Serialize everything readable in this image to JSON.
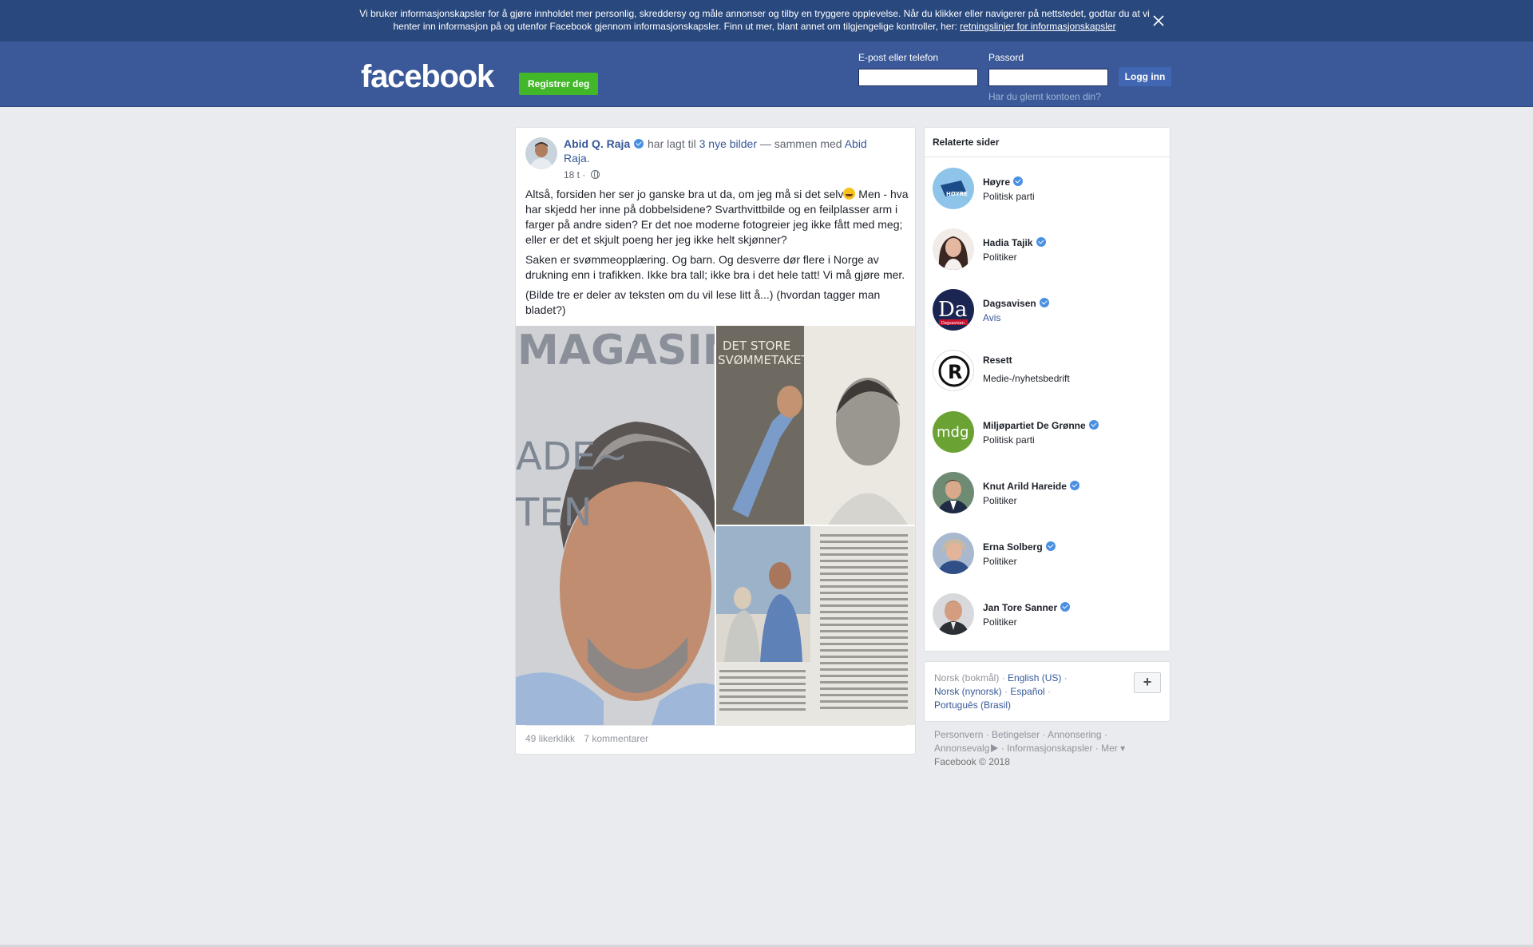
{
  "cookie": {
    "text": "Vi bruker informasjonskapsler for å gjøre innholdet mer personlig, skreddersy og måle annonser og tilby en tryggere opplevelse. Når du klikker eller navigerer på nettstedet, godtar du at vi henter inn informasjon på og utenfor Facebook gjennom informasjonskapsler. Finn ut mer, blant annet om tilgjengelige kontroller, her: ",
    "link": "retningslinjer for informasjonskapsler"
  },
  "header": {
    "logo": "facebook",
    "register": "Registrer deg",
    "email_label": "E-post eller telefon",
    "password_label": "Passord",
    "login": "Logg inn",
    "forgot": "Har du glemt kontoen din?"
  },
  "post": {
    "author": "Abid Q. Raja",
    "action": " har lagt til ",
    "photos_link": "3 nye bilder",
    "with": " — sammen med ",
    "tagged": "Abid Raja",
    "time": "18 t",
    "text_1a": "Altså, forsiden her ser jo ganske bra ut da, om jeg må si det selv",
    "text_1b": " Men - hva har skjedd her inne på dobbelsidene? Svarthvittbilde og en feilplasser arm i farger på andre siden? Er det noe moderne fotogreier jeg ikke fått med meg; eller er det et skjult poeng her jeg ikke helt skjønner?",
    "text_2": "Saken er svømmeopplæring. Og barn. Og desverre dør flere i Norge av drukning enn i trafikken. Ikke bra tall; ikke bra i det hele tatt! Vi må gjøre mer.",
    "text_3": "(Bilde tre er deler av teksten om du vil lese litt å...) (hvordan tagger man bladet?)",
    "photo1_text": "MAGASIN",
    "photo1_side": "ADE~ TEN",
    "photo2_text": "DET STORE SVØMMETAKET",
    "likes": "49 likerklikk",
    "comments": "7 kommentarer"
  },
  "related": {
    "title": "Relaterte sider",
    "items": [
      {
        "name": "Høyre",
        "category": "Politisk parti",
        "verified": true
      },
      {
        "name": "Hadia Tajik",
        "category": "Politiker",
        "verified": true
      },
      {
        "name": "Dagsavisen",
        "category": "Avis",
        "verified": true
      },
      {
        "name": "Resett",
        "category": "Medie-/nyhetsbedrift",
        "verified": false
      },
      {
        "name": "Miljøpartiet De Grønne",
        "category": "Politisk parti",
        "verified": true
      },
      {
        "name": "Knut Arild Hareide",
        "category": "Politiker",
        "verified": true
      },
      {
        "name": "Erna Solberg",
        "category": "Politiker",
        "verified": true
      },
      {
        "name": "Jan Tore Sanner",
        "category": "Politiker",
        "verified": true
      }
    ],
    "avatar_labels": {
      "hoyre": "HØYRE",
      "dagsavisen": "Da",
      "dagsavisen_small": "Dagsavisen",
      "resett": "R",
      "mdg": "mdg"
    }
  },
  "languages": {
    "current": "Norsk (bokmål)",
    "english": "English (US)",
    "nynorsk": "Norsk (nynorsk)",
    "spanish": "Español",
    "portuguese": "Português (Brasil)",
    "plus": "+"
  },
  "footer": {
    "privacy": "Personvern",
    "terms": "Betingelser",
    "ads": "Annonsering",
    "ad_choices": "Annonsevalg",
    "cookies": "Informasjonskapsler",
    "more": "Mer",
    "copyright": "Facebook © 2018"
  },
  "colors": {
    "brand": "#3b5998",
    "banner": "#29487d",
    "register": "#42b72a",
    "link": "#365899"
  }
}
